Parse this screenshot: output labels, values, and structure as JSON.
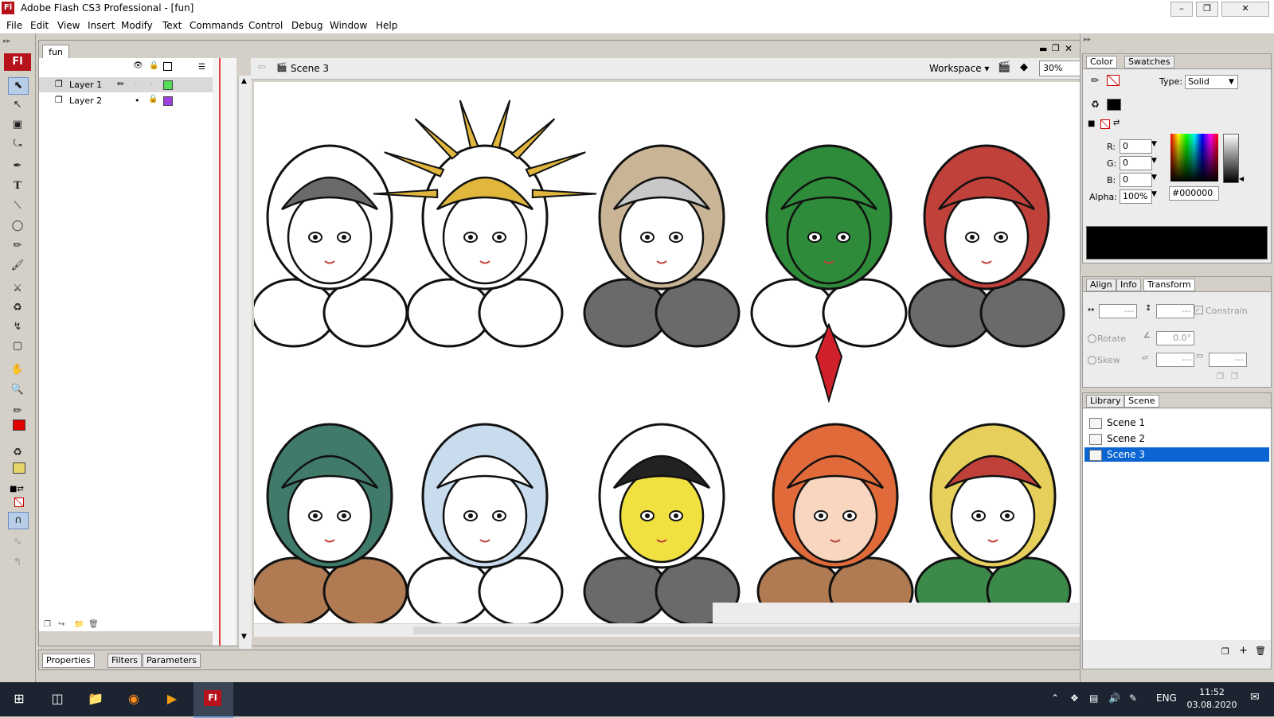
{
  "window": {
    "title": "Adobe Flash CS3 Professional - [fun]",
    "app_icon": "Fl",
    "buttons": [
      "minimize-icon",
      "restore-icon",
      "close-icon"
    ]
  },
  "menu": [
    "File",
    "Edit",
    "View",
    "Insert",
    "Modify",
    "Text",
    "Commands",
    "Control",
    "Debug",
    "Window",
    "Help"
  ],
  "tools": {
    "logo": "Fl",
    "items": [
      "selection-tool-icon",
      "subselection-tool-icon",
      "free-transform-tool-icon",
      "lasso-tool-icon",
      "pen-tool-icon",
      "text-tool-icon",
      "line-tool-icon",
      "oval-tool-icon",
      "pencil-tool-icon",
      "brush-tool-icon",
      "ink-bottle-tool-icon",
      "paint-bucket-tool-icon",
      "eyedropper-tool-icon",
      "eraser-tool-icon",
      "hand-tool-icon",
      "zoom-tool-icon",
      "stroke-color-icon",
      "fill-color-icon",
      "snap-to-objects-icon"
    ],
    "stroke_color": "#e00000",
    "fill_color": "#e7d468"
  },
  "document": {
    "tab": "fun",
    "scene": "Scene 3",
    "workspace": "Workspace",
    "zoom": "30%"
  },
  "timeline": {
    "layers": [
      {
        "name": "Layer 1",
        "color": "#55dd55",
        "selected": true
      },
      {
        "name": "Layer 2",
        "color": "#9b3fe0",
        "selected": false
      }
    ]
  },
  "properties": {
    "tabs": [
      "Properties",
      "Filters",
      "Parameters"
    ]
  },
  "color_panel": {
    "tabs": [
      "Color",
      "Swatches"
    ],
    "type_label": "Type:",
    "type_value": "Solid",
    "r_label": "R:",
    "r": "0",
    "g_label": "G:",
    "g": "0",
    "b_label": "B:",
    "b": "0",
    "alpha_label": "Alpha:",
    "alpha": "100%",
    "hex": "#000000",
    "preview_color": "#000000"
  },
  "transform_panel": {
    "tabs": [
      "Align",
      "Info",
      "Transform"
    ],
    "width": "---",
    "height": "---",
    "constrain": "Constrain",
    "rotate_label": "Rotate",
    "rotate_value": "0.0°",
    "skew_label": "Skew",
    "skew_w": "---",
    "skew_h": "---"
  },
  "scene_panel": {
    "tabs": [
      "Library",
      "Scene"
    ],
    "scenes": [
      "Scene 1",
      "Scene 2",
      "Scene 3"
    ],
    "selected": "Scene 3"
  },
  "taskbar": {
    "icons": [
      "windows-start-icon",
      "task-view-icon",
      "file-explorer-icon",
      "firefox-icon",
      "media-player-icon",
      "flash-taskbar-icon"
    ],
    "flash_label": "Fl",
    "language": "ENG",
    "time": "11:52",
    "date": "03.08.2020"
  },
  "stage": {
    "palette": {
      "brown": "#b07a52",
      "gold": "#e0b63d",
      "tan": "#c9b596",
      "green": "#2e8b3a",
      "red": "#c0403a",
      "gray": "#6a6a6a",
      "teal": "#3f7a6a",
      "lightblue": "#c8dcee",
      "black": "#222222",
      "yellow": "#f0e040",
      "orange": "#e06a3a",
      "skin": "#f8d6c0",
      "blonde": "#e6cf5a",
      "darkgreen": "#3c8a4a"
    }
  }
}
